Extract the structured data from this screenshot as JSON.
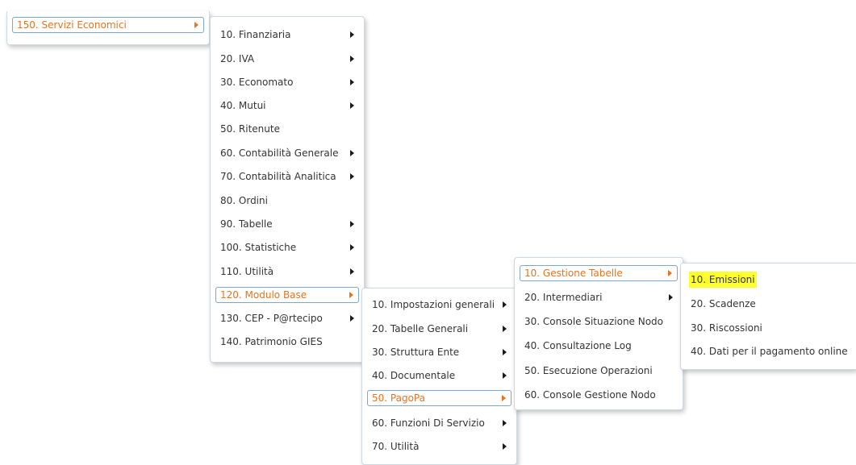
{
  "colors": {
    "active_text": "#e8731f",
    "active_border": "#7fa6cc",
    "highlight": "#ffff2e",
    "arrow": "#1a1a1a"
  },
  "root_menu": {
    "item": "150. Servizi Economici"
  },
  "servizi_economici_menu": {
    "items": [
      "10. Finanziaria",
      "20. IVA",
      "30. Economato",
      "40. Mutui",
      "50. Ritenute",
      "60. Contabilità Generale",
      "70. Contabilità Analitica",
      "80. Ordini",
      "90. Tabelle",
      "100. Statistiche",
      "110. Utilità",
      "120. Modulo Base",
      "130. CEP - P@rtecipo",
      "140. Patrimonio GIES"
    ]
  },
  "modulo_base_menu": {
    "items": [
      "10. Impostazioni generali",
      "20. Tabelle Generali",
      "30. Struttura Ente",
      "40. Documentale",
      "50. PagoPa",
      "60. Funzioni Di Servizio",
      "70. Utilità"
    ]
  },
  "pagopa_menu": {
    "items": [
      "10. Gestione Tabelle",
      "20. Intermediari",
      "30. Console Situazione Nodo",
      "40. Consultazione Log",
      "50. Esecuzione Operazioni",
      "60. Console Gestione Nodo"
    ]
  },
  "gestione_tabelle_menu": {
    "items": [
      "10. Emissioni",
      "20. Scadenze",
      "30. Riscossioni",
      "40. Dati per il pagamento online"
    ]
  }
}
